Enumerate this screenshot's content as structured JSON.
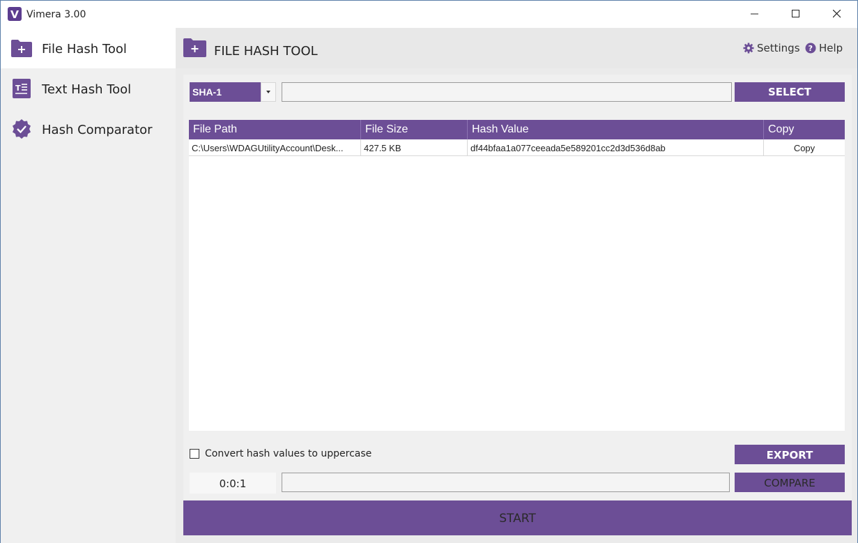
{
  "window": {
    "title": "Vimera 3.00"
  },
  "sidebar": {
    "items": [
      {
        "label": "File Hash Tool",
        "icon": "folder-plus-icon",
        "active": true
      },
      {
        "label": "Text Hash Tool",
        "icon": "text-document-icon",
        "active": false
      },
      {
        "label": "Hash Comparator",
        "icon": "badge-check-icon",
        "active": false
      }
    ]
  },
  "header": {
    "title": "FILE HASH TOOL",
    "settings_label": "Settings",
    "help_label": "Help"
  },
  "controls": {
    "algorithm_selected": "SHA-1",
    "path_value": "",
    "select_label": "SELECT",
    "uppercase_label": "Convert hash values to uppercase",
    "uppercase_checked": false,
    "export_label": "EXPORT",
    "timer": "0:0:1",
    "compare_value": "",
    "compare_label": "COMPARE",
    "start_label": "START"
  },
  "table": {
    "columns": [
      "File Path",
      "File Size",
      "Hash Value",
      "Copy"
    ],
    "rows": [
      {
        "path": "C:\\Users\\WDAGUtilityAccount\\Desk...",
        "size": "427.5 KB",
        "hash": "df44bfaa1a077ceeada5e589201cc2d3d536d8ab",
        "copy": "Copy"
      }
    ]
  },
  "colors": {
    "accent": "#6c4e96",
    "sidebar_bg": "#f0f0f0",
    "main_bg": "#ebebeb"
  }
}
